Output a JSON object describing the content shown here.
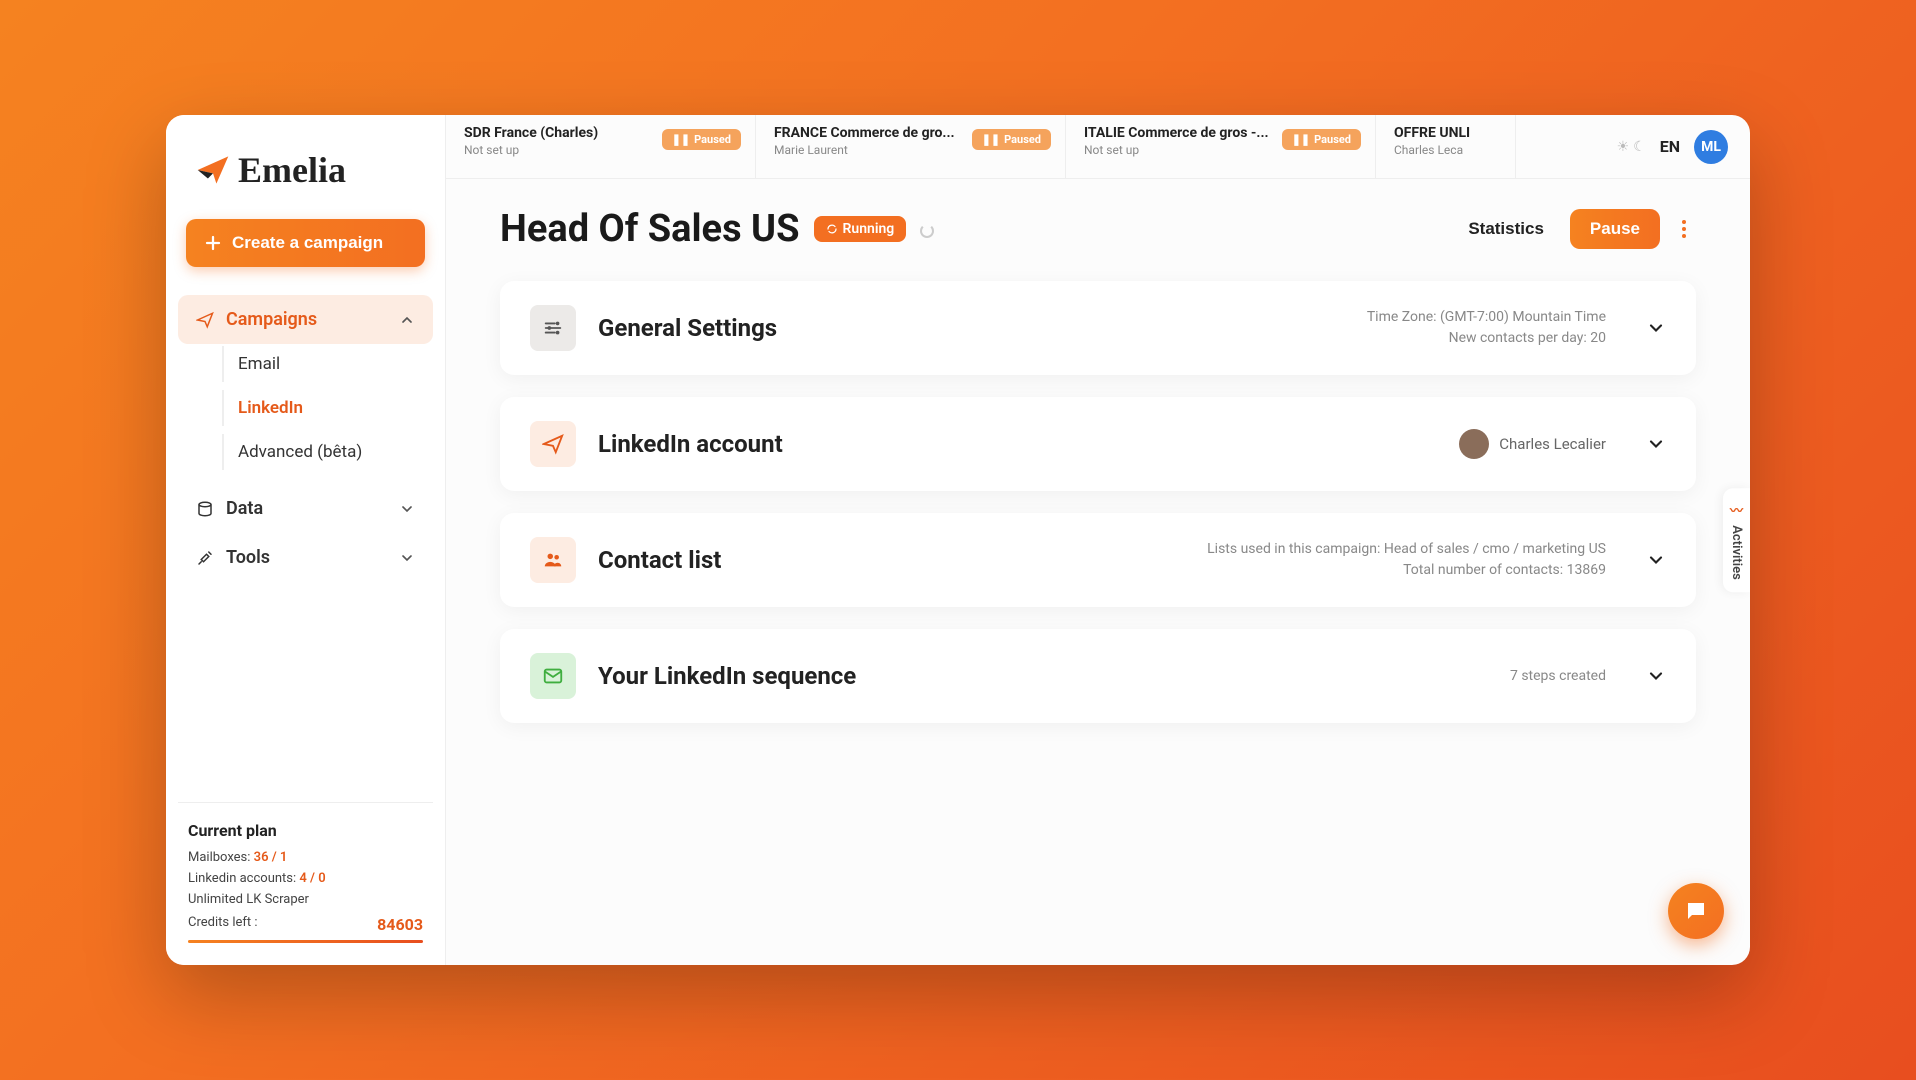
{
  "brand": "Emelia",
  "sidebar": {
    "create_label": "Create a campaign",
    "items": {
      "campaigns": "Campaigns",
      "data": "Data",
      "tools": "Tools"
    },
    "campaign_sub": {
      "email": "Email",
      "linkedin": "LinkedIn",
      "advanced": "Advanced (bêta)"
    },
    "plan": {
      "title": "Current plan",
      "mailboxes_label": "Mailboxes:",
      "mailboxes_value": "36 / 1",
      "linkedin_label": "Linkedin accounts:",
      "linkedin_value": "4 / 0",
      "scraper": "Unlimited LK Scraper",
      "credits_label": "Credits left :",
      "credits_value": "84603"
    }
  },
  "tabs": [
    {
      "title": "SDR France (Charles)",
      "sub": "Not set up",
      "status": "Paused"
    },
    {
      "title": "FRANCE Commerce de gro...",
      "sub": "Marie Laurent",
      "status": "Paused"
    },
    {
      "title": "ITALIE Commerce de gros -...",
      "sub": "Not set up",
      "status": "Paused"
    },
    {
      "title": "OFFRE UNLI",
      "sub": "Charles Leca",
      "status": ""
    }
  ],
  "top": {
    "lang": "EN",
    "avatar_initials": "ML"
  },
  "page": {
    "title": "Head Of Sales US",
    "status": "Running",
    "statistics": "Statistics",
    "pause": "Pause"
  },
  "cards": {
    "general": {
      "title": "General Settings",
      "tz_label": "Time Zone:",
      "tz_value": "(GMT-7:00) Mountain Time",
      "contacts_label": "New contacts per day:",
      "contacts_value": "20"
    },
    "linkedin_acct": {
      "title": "LinkedIn account",
      "user": "Charles Lecalier"
    },
    "contacts": {
      "title": "Contact list",
      "lists_label": "Lists used in this campaign:",
      "lists_value": "Head of sales / cmo / marketing US",
      "total_label": "Total number of contacts:",
      "total_value": "13869"
    },
    "sequence": {
      "title": "Your LinkedIn sequence",
      "steps": "7 steps created"
    }
  },
  "activities_label": "Activities"
}
